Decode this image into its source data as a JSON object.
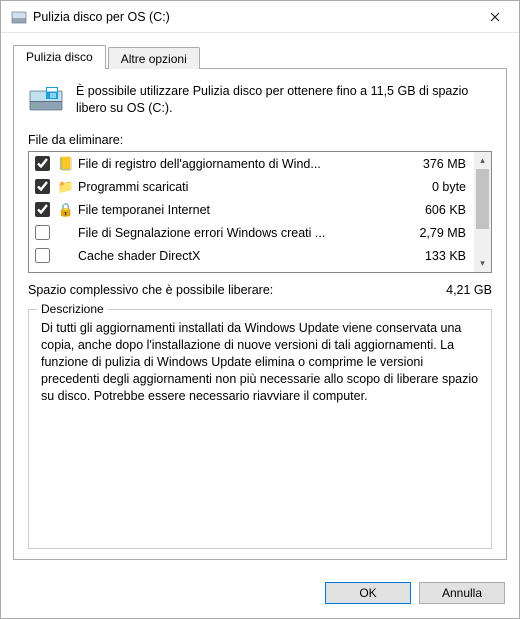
{
  "window": {
    "title": "Pulizia disco per OS (C:)"
  },
  "tabs": {
    "main": "Pulizia disco",
    "other": "Altre opzioni"
  },
  "intro": "È possibile utilizzare Pulizia disco per ottenere fino a 11,5 GB di spazio libero su OS (C:).",
  "files_label": "File da eliminare:",
  "files": [
    {
      "checked": true,
      "icon": "📒",
      "name": "File di registro dell'aggiornamento di Wind...",
      "size": "376 MB"
    },
    {
      "checked": true,
      "icon": "📁",
      "name": "Programmi scaricati",
      "size": "0 byte"
    },
    {
      "checked": true,
      "icon": "🔒",
      "name": "File temporanei Internet",
      "size": "606 KB"
    },
    {
      "checked": false,
      "icon": "",
      "name": "File di Segnalazione errori Windows creati ...",
      "size": "2,79 MB"
    },
    {
      "checked": false,
      "icon": "",
      "name": "Cache shader DirectX",
      "size": "133 KB"
    }
  ],
  "total": {
    "label": "Spazio complessivo che è possibile liberare:",
    "value": "4,21 GB"
  },
  "description": {
    "heading": "Descrizione",
    "text": "Di tutti gli aggiornamenti installati da Windows Update viene conservata una copia, anche dopo l'installazione di nuove versioni di tali aggiornamenti. La funzione di pulizia di Windows Update elimina o comprime le versioni precedenti degli aggiornamenti non più necessarie allo scopo di liberare spazio su disco. Potrebbe essere necessario riavviare il computer."
  },
  "buttons": {
    "ok": "OK",
    "cancel": "Annulla"
  }
}
